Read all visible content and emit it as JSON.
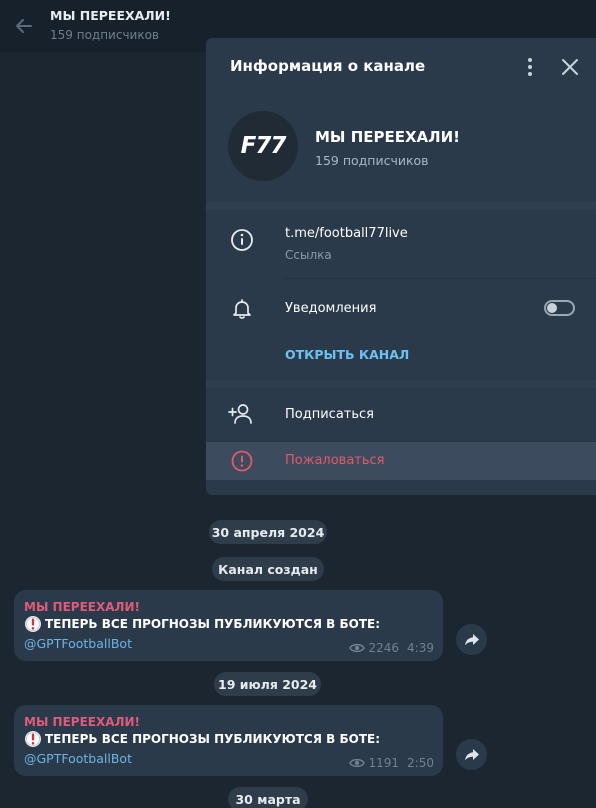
{
  "header": {
    "title": "МЫ ПЕРЕЕХАЛИ!",
    "subtitle": "159 подписчиков"
  },
  "info_panel": {
    "title": "Информация о канале",
    "avatar_text": "F77",
    "channel_name": "МЫ ПЕРЕЕХАЛИ!",
    "subscribers": "159 подписчиков",
    "link": "t.me/football77live",
    "link_caption": "Ссылка",
    "notifications_label": "Уведомления",
    "notifications_on": false,
    "open_channel_label": "ОТКРЫТЬ КАНАЛ",
    "subscribe_label": "Подписаться",
    "report_label": "Пожаловаться"
  },
  "chat": {
    "date_1": "30 апреля 2024",
    "service_created": "Канал создан",
    "date_2": "19 июля 2024",
    "date_3": "30 марта",
    "messages": [
      {
        "author": "МЫ ПЕРЕЕХАЛИ!",
        "text": "ТЕПЕРЬ ВСЕ ПРОГНОЗЫ ПУБЛИКУЮТСЯ В БОТЕ:",
        "link": "@GPTFootballBot",
        "views": "2246",
        "time": "4:39"
      },
      {
        "author": "МЫ ПЕРЕЕХАЛИ!",
        "text": "ТЕПЕРЬ ВСЕ ПРОГНОЗЫ ПУБЛИКУЮТСЯ В БОТЕ:",
        "link": "@GPTFootballBot",
        "views": "1191",
        "time": "2:50"
      }
    ]
  },
  "colors": {
    "background": "#1c2631",
    "panel": "#2b3a4a",
    "accent_link": "#6cc1f0",
    "danger": "#e05a6a",
    "author": "#e05a79"
  },
  "icons": {
    "back": "arrow-left-icon",
    "more": "more-vertical-icon",
    "close": "close-icon",
    "info": "info-icon",
    "bell": "bell-icon",
    "add_user": "add-user-icon",
    "report": "alert-circle-icon",
    "eye": "eye-icon",
    "forward": "forward-icon",
    "warning": "exclamation-icon"
  }
}
